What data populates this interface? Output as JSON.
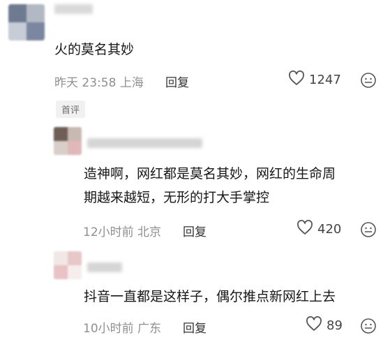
{
  "main_comment": {
    "text": "火的莫名其妙",
    "time": "昨天 23:58",
    "location": "上海",
    "reply_label": "回复",
    "likes": "1247",
    "badge": "首评"
  },
  "replies": [
    {
      "text_line1": "造神啊，网红都是莫名其妙，网红的生命周",
      "text_line2": "期越来越短，无形的打大手掌控",
      "time": "12小时前",
      "location": "北京",
      "reply_label": "回复",
      "likes": "420"
    },
    {
      "text_line1": "抖音一直都是这样子，偶尔推点新网红上去",
      "time": "10小时前",
      "location": "广东",
      "reply_label": "回复",
      "likes": "89"
    }
  ],
  "icons": {
    "like": "heart-outline-icon",
    "emoji": "smiley-face-icon"
  }
}
